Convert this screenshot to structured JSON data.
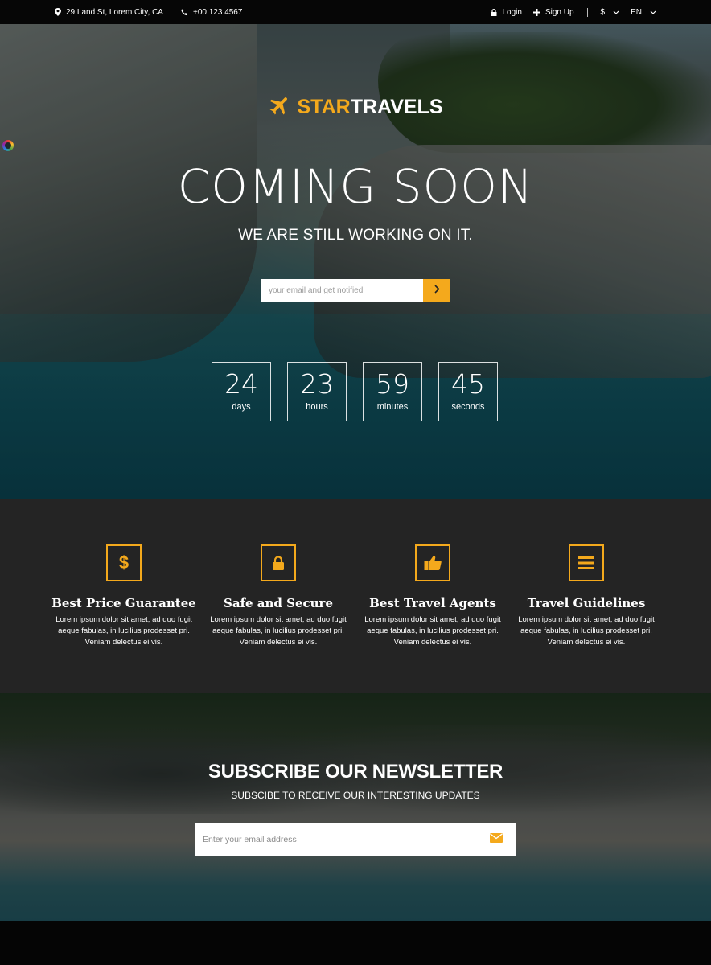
{
  "topbar": {
    "address": "29 Land St, Lorem City, CA",
    "phone": "+00 123 4567",
    "login": "Login",
    "signup": "Sign Up",
    "currency": "$",
    "language": "EN"
  },
  "hero": {
    "logo_star": "STAR",
    "logo_travels": "TRAVELS",
    "heading": "COMING SOON",
    "tagline": "WE ARE STILL WORKING ON IT.",
    "email_placeholder": "your email and get notified",
    "countdown": [
      {
        "value": "24",
        "label": "days"
      },
      {
        "value": "23",
        "label": "hours"
      },
      {
        "value": "59",
        "label": "minutes"
      },
      {
        "value": "45",
        "label": "seconds"
      }
    ]
  },
  "features": [
    {
      "icon": "dollar-icon",
      "title": "Best Price Guarantee",
      "text": "Lorem ipsum dolor sit amet, ad duo fugit aeque fabulas, in lucilius prodesset pri. Veniam delectus ei vis."
    },
    {
      "icon": "lock-icon",
      "title": "Safe and Secure",
      "text": "Lorem ipsum dolor sit amet, ad duo fugit aeque fabulas, in lucilius prodesset pri. Veniam delectus ei vis."
    },
    {
      "icon": "thumbs-up-icon",
      "title": "Best Travel Agents",
      "text": "Lorem ipsum dolor sit amet, ad duo fugit aeque fabulas, in lucilius prodesset pri. Veniam delectus ei vis."
    },
    {
      "icon": "list-icon",
      "title": "Travel Guidelines",
      "text": "Lorem ipsum dolor sit amet, ad duo fugit aeque fabulas, in lucilius prodesset pri. Veniam delectus ei vis."
    }
  ],
  "newsletter": {
    "title": "SUBSCRIBE OUR NEWSLETTER",
    "subtitle": "SUBSCIBE TO RECEIVE OUR INTERESTING UPDATES",
    "placeholder": "Enter your email address"
  },
  "colors": {
    "accent": "#f4a91c",
    "features_bg": "#242424",
    "topbar_bg": "#060606"
  }
}
